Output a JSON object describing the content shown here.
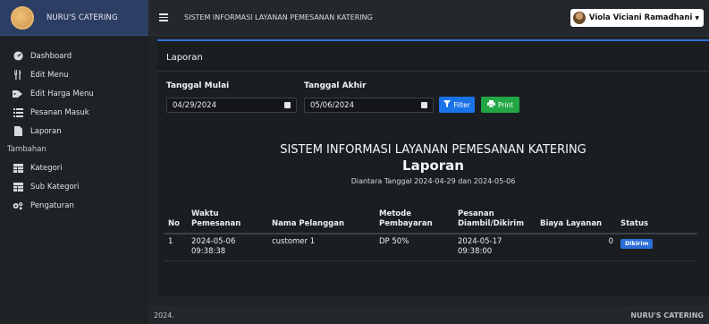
{
  "brand": {
    "name": "NURU'S CATERING"
  },
  "sidebar": {
    "items": [
      {
        "label": "Dashboard",
        "icon": "dashboard-icon"
      },
      {
        "label": "Edit Menu",
        "icon": "utensils-icon"
      },
      {
        "label": "Edit Harga Menu",
        "icon": "tag-icon"
      },
      {
        "label": "Pesanan Masuk",
        "icon": "list-icon"
      },
      {
        "label": "Laporan",
        "icon": "file-icon"
      }
    ],
    "section_heading": "Tambahan",
    "extra_items": [
      {
        "label": "Kategori",
        "icon": "table-icon"
      },
      {
        "label": "Sub Kategori",
        "icon": "table-icon"
      },
      {
        "label": "Pengaturan",
        "icon": "gears-icon"
      }
    ]
  },
  "topbar": {
    "title": "SISTEM INFORMASI LAYANAN PEMESANAN KATERING",
    "user_name": "Viola Viciani Ramadhani"
  },
  "page": {
    "card_title": "Laporan",
    "start_label": "Tanggal Mulai",
    "start_value": "04/29/2024",
    "end_label": "Tanggal Akhir",
    "end_value": "05/06/2024",
    "filter_label": "Filter",
    "print_label": "Print"
  },
  "report": {
    "title": "SISTEM INFORMASI LAYANAN PEMESANAN KATERING",
    "subtitle": "Laporan",
    "range": "Diantara Tanggal 2024-04-29 dan 2024-05-06"
  },
  "table": {
    "headers": [
      "No",
      "Waktu Pemesanan",
      "Nama Pelanggan",
      "Metode Pembayaran",
      "Pesanan Diambil/Dikirim",
      "Biaya Layanan",
      "Status"
    ],
    "rows": [
      {
        "no": "1",
        "waktu": "2024-05-06 09:38:38",
        "nama": "customer 1",
        "metode": "DP 50%",
        "pesanan": "2024-05-17 09:38:00",
        "biaya": "0",
        "status": "Dikirim"
      }
    ]
  },
  "footer": {
    "left": "2024.",
    "right": "NURU'S CATERING"
  },
  "colors": {
    "brand_bg": "#2d3e64",
    "accent": "#2f6fd6",
    "filter_btn": "#1a73e8",
    "print_btn": "#22a744",
    "badge": "#2c6ed9"
  }
}
